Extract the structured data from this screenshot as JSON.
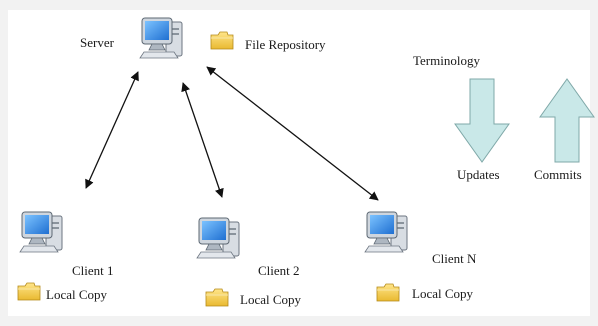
{
  "server": {
    "label": "Server",
    "icon": "computer-icon"
  },
  "repository": {
    "label": "File Repository",
    "icon": "folder-icon"
  },
  "clients": [
    {
      "label": "Client 1",
      "copy_label": "Local Copy"
    },
    {
      "label": "Client 2",
      "copy_label": "Local Copy"
    },
    {
      "label": "Client N",
      "copy_label": "Local Copy"
    }
  ],
  "terminology": {
    "title": "Terminology",
    "updates_label": "Updates",
    "commits_label": "Commits"
  },
  "colors": {
    "background": "#f2f2f2",
    "arrow_fill": "#c9e8e8",
    "arrow_stroke": "#7fa8a8",
    "folder": "#f7d35c",
    "monitor_screen": "#2e8ee6"
  }
}
